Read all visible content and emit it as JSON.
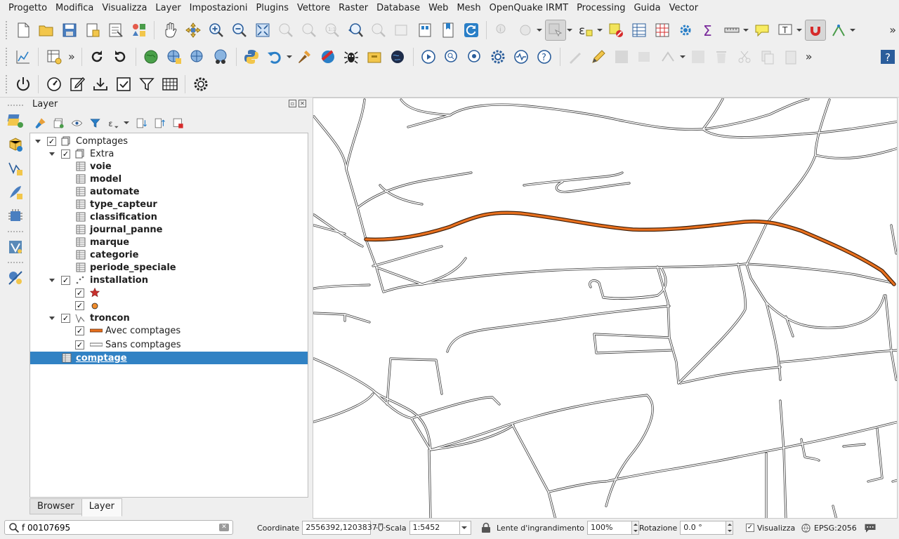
{
  "menubar": {
    "items": [
      "Progetto",
      "Modifica",
      "Visualizza",
      "Layer",
      "Impostazioni",
      "Plugins",
      "Vettore",
      "Raster",
      "Database",
      "Web",
      "Mesh",
      "OpenQuake IRMT",
      "Processing",
      "Guida",
      "Vector"
    ]
  },
  "layer_panel": {
    "title": "Layer",
    "tree": [
      {
        "label": "Comptages",
        "level": 0,
        "expanded": true,
        "checked": true,
        "icon": "group-icon",
        "bold": false
      },
      {
        "label": "Extra",
        "level": 1,
        "expanded": true,
        "checked": true,
        "icon": "group-icon",
        "bold": false
      },
      {
        "label": "voie",
        "level": 2,
        "checked": null,
        "icon": "table-icon",
        "bold": true
      },
      {
        "label": "model",
        "level": 2,
        "checked": null,
        "icon": "table-icon",
        "bold": true
      },
      {
        "label": "automate",
        "level": 2,
        "checked": null,
        "icon": "table-icon",
        "bold": true
      },
      {
        "label": "type_capteur",
        "level": 2,
        "checked": null,
        "icon": "table-icon",
        "bold": true
      },
      {
        "label": "classification",
        "level": 2,
        "checked": null,
        "icon": "table-icon",
        "bold": true
      },
      {
        "label": "journal_panne",
        "level": 2,
        "checked": null,
        "icon": "table-icon",
        "bold": true
      },
      {
        "label": "marque",
        "level": 2,
        "checked": null,
        "icon": "table-icon",
        "bold": true
      },
      {
        "label": "categorie",
        "level": 2,
        "checked": null,
        "icon": "table-icon",
        "bold": true
      },
      {
        "label": "periode_speciale",
        "level": 2,
        "checked": null,
        "icon": "table-icon",
        "bold": true
      },
      {
        "label": "installation",
        "level": 1,
        "expanded": true,
        "checked": true,
        "icon": "point-layer-icon",
        "bold": true
      },
      {
        "label": "",
        "level": 2,
        "checked": true,
        "icon": "red-star-symbol-icon",
        "bold": false
      },
      {
        "label": "",
        "level": 2,
        "checked": true,
        "icon": "orange-dot-symbol-icon",
        "bold": false
      },
      {
        "label": "troncon",
        "level": 1,
        "expanded": true,
        "checked": true,
        "icon": "line-layer-icon",
        "bold": true
      },
      {
        "label": "Avec comptages",
        "level": 2,
        "checked": true,
        "icon": "orange-line-symbol-icon",
        "bold": false
      },
      {
        "label": "Sans comptages",
        "level": 2,
        "checked": true,
        "icon": "white-line-symbol-icon",
        "bold": false
      },
      {
        "label": "comptage",
        "level": 0,
        "checked": null,
        "icon": "table-icon",
        "bold": true,
        "selected": true
      }
    ],
    "tabs": [
      "Browser",
      "Layer"
    ],
    "active_tab": "Layer"
  },
  "statusbar": {
    "locator_value": "f 00107695",
    "coord_label": "Coordinate",
    "coord_value": "2556392,1203837",
    "scale_label": "Scala",
    "scale_value": "1:5452",
    "magnifier_label": "Lente d'ingrandimento",
    "magnifier_value": "100%",
    "rotation_label": "Rotazione",
    "rotation_value": "0.0 °",
    "render_label": "Visualizza",
    "render_checked": true,
    "crs_label": "EPSG:2056"
  },
  "colors": {
    "selection": "#3182c4",
    "road_highlight": "#e8701e",
    "accent_blue": "#2a7fc7",
    "snap_red": "#d62b2b"
  }
}
